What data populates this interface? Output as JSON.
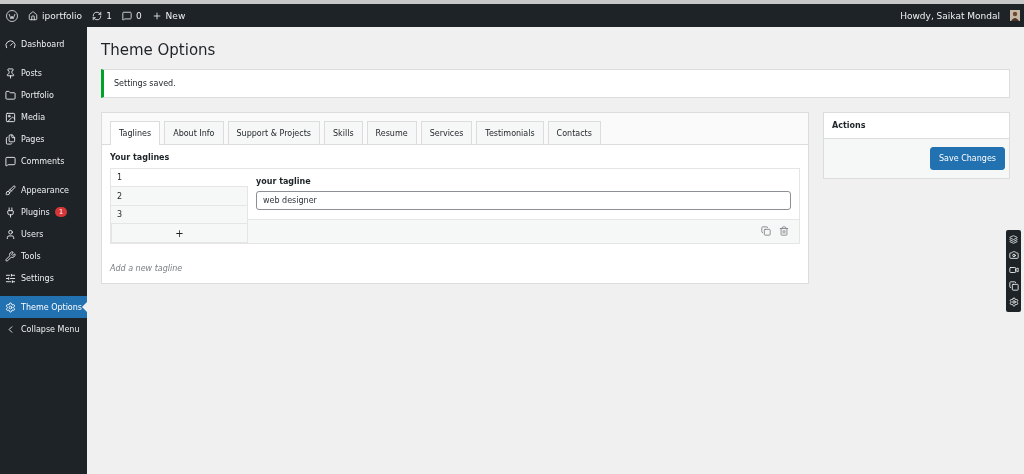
{
  "admin_bar": {
    "site": "iportfolio",
    "updates": "1",
    "comments": "0",
    "new": "New",
    "greeting": "Howdy, Saikat Mondal"
  },
  "sidebar": {
    "groups": [
      {
        "items": [
          {
            "label": "Dashboard",
            "selected": false
          }
        ]
      },
      {
        "items": [
          {
            "label": "Posts",
            "selected": false
          },
          {
            "label": "Portfolio",
            "selected": false
          },
          {
            "label": "Media",
            "selected": false
          },
          {
            "label": "Pages",
            "selected": false
          },
          {
            "label": "Comments",
            "selected": false
          }
        ]
      },
      {
        "items": [
          {
            "label": "Appearance",
            "selected": false
          },
          {
            "label": "Plugins",
            "selected": false,
            "badge": "1"
          },
          {
            "label": "Users",
            "selected": false
          },
          {
            "label": "Tools",
            "selected": false
          },
          {
            "label": "Settings",
            "selected": false
          }
        ]
      },
      {
        "items": [
          {
            "label": "Theme Options",
            "selected": true
          },
          {
            "label": "Collapse Menu",
            "selected": false
          }
        ]
      }
    ]
  },
  "page": {
    "title": "Theme Options",
    "notice": "Settings saved."
  },
  "tabs": [
    {
      "label": "Taglines",
      "selected": true
    },
    {
      "label": "About Info",
      "selected": false
    },
    {
      "label": "Support & Projects",
      "selected": false
    },
    {
      "label": "Skills",
      "selected": false
    },
    {
      "label": "Resume",
      "selected": false
    },
    {
      "label": "Services",
      "selected": false
    },
    {
      "label": "Testimonials",
      "selected": false
    },
    {
      "label": "Contacts",
      "selected": false
    }
  ],
  "taglines": {
    "heading": "Your taglines",
    "items": [
      {
        "label": "1",
        "selected": true
      },
      {
        "label": "2",
        "selected": false
      },
      {
        "label": "3",
        "selected": false
      }
    ],
    "add_button": "+",
    "field_label": "your tagline",
    "field_value": "web designer",
    "hint": "Add a new tagline"
  },
  "actions": {
    "title": "Actions",
    "button": "Save Changes"
  }
}
